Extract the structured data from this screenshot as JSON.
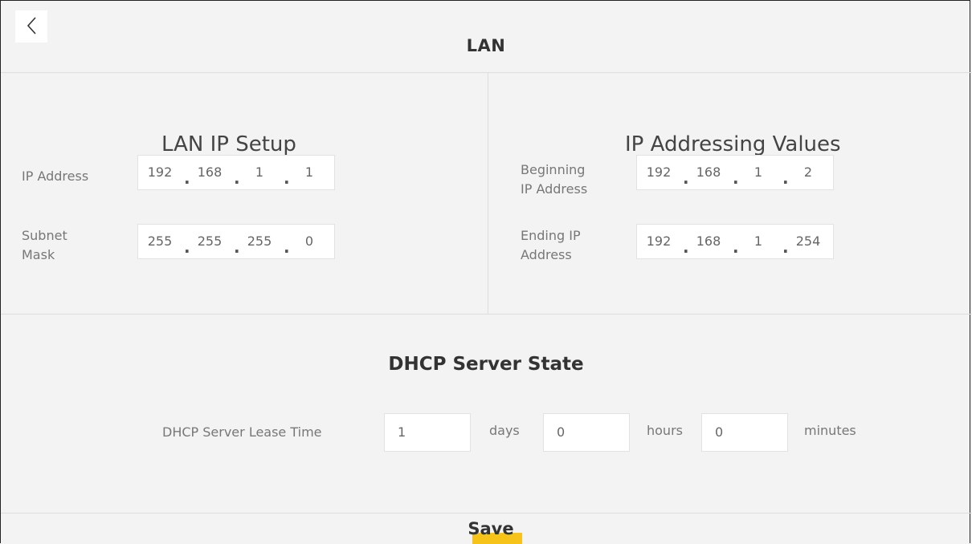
{
  "header": {
    "title": "LAN",
    "back_icon": "chevron-left-icon"
  },
  "lan_ip_setup": {
    "title": "LAN IP Setup",
    "ip_address": {
      "label": "IP Address",
      "octets": [
        "192",
        "168",
        "1",
        "1"
      ]
    },
    "subnet_mask": {
      "label_line1": "Subnet",
      "label_line2": "Mask",
      "octets": [
        "255",
        "255",
        "255",
        "0"
      ]
    }
  },
  "ip_addressing_values": {
    "title": "IP Addressing Values",
    "beginning": {
      "label_line1": "Beginning",
      "label_line2": "IP Address",
      "octets": [
        "192",
        "168",
        "1",
        "2"
      ]
    },
    "ending": {
      "label_line1": "Ending IP",
      "label_line2": "Address",
      "octets": [
        "192",
        "168",
        "1",
        "254"
      ]
    }
  },
  "dhcp": {
    "title": "DHCP Server State",
    "lease_label": "DHCP Server Lease Time",
    "days_value": "1",
    "days_unit": "days",
    "hours_value": "0",
    "hours_unit": "hours",
    "minutes_value": "0",
    "minutes_unit": "minutes"
  },
  "footer": {
    "save_label": "Save",
    "accent_color": "#f6c31a"
  }
}
